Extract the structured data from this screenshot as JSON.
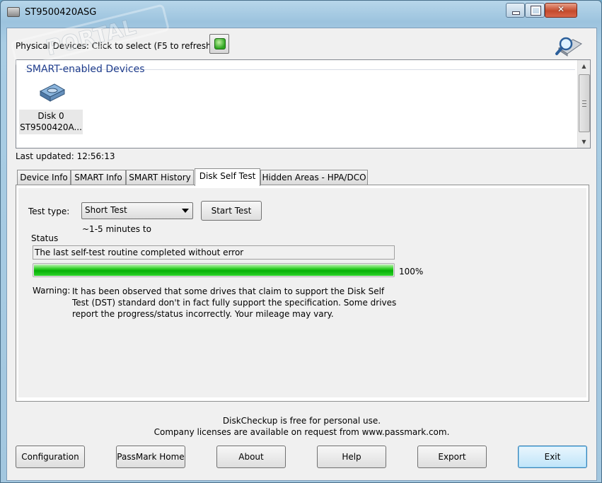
{
  "window": {
    "title": "ST9500420ASG"
  },
  "devices": {
    "label": "Physical Devices: Click to select (F5 to refresh)",
    "header": "SMART-enabled Devices",
    "items": [
      {
        "name": "Disk 0",
        "model": "ST9500420A..."
      }
    ]
  },
  "last_updated": "Last updated: 12:56:13",
  "tabs": [
    {
      "label": "Device Info"
    },
    {
      "label": "SMART Info"
    },
    {
      "label": "SMART History"
    },
    {
      "label": "Disk Self Test"
    },
    {
      "label": "Hidden Areas - HPA/DCO"
    }
  ],
  "self_test": {
    "test_type_label": "Test type:",
    "test_type_value": "Short Test",
    "start_button": "Start Test",
    "duration": "~1-5 minutes to",
    "status_label": "Status",
    "status_text": "The last self-test routine completed without error",
    "progress_value": 1.0,
    "progress_text": "100%",
    "warning_label": "Warning:",
    "warning_text": "It has been observed that some drives that claim to support the Disk Self Test (DST) standard don't in fact fully support the specification. Some drives report the progress/status incorrectly. Your mileage may vary."
  },
  "footer": {
    "line1": "DiskCheckup is free for personal use.",
    "line2": "Company licenses are available on request from www.passmark.com."
  },
  "buttons": {
    "configuration": "Configuration",
    "passmark_home": "PassMark Home",
    "about": "About",
    "help": "Help",
    "export": "Export",
    "exit": "Exit"
  },
  "watermark": {
    "text": "PORTAL"
  },
  "colors": {
    "progress": "#06b006",
    "header_blue": "#1e3c8c"
  }
}
